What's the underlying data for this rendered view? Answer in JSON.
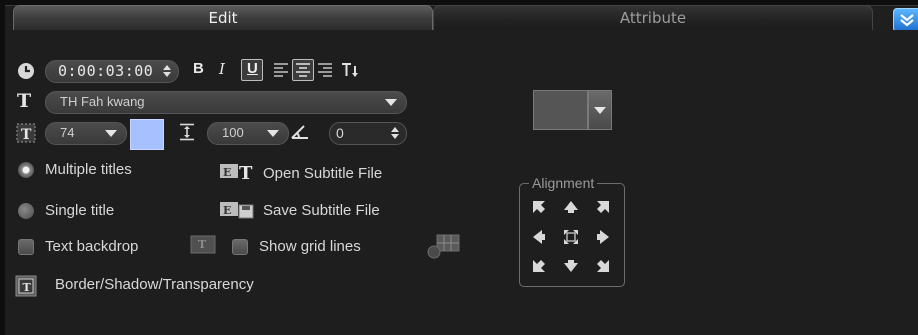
{
  "tabs": {
    "edit": "Edit",
    "attribute": "Attribute"
  },
  "time": {
    "value": "0:00:03:00"
  },
  "format": {
    "bold": "B",
    "italic": "I",
    "underline": "U"
  },
  "font": {
    "name": "TH Fah kwang",
    "size": "74",
    "line_spacing": "100",
    "rotation": "0"
  },
  "options": {
    "multiple_titles": "Multiple titles",
    "single_title": "Single title",
    "open_subtitle": "Open Subtitle File",
    "save_subtitle": "Save Subtitle File",
    "text_backdrop": "Text backdrop",
    "show_grid": "Show grid lines",
    "border_shadow": "Border/Shadow/Transparency"
  },
  "alignment": {
    "label": "Alignment"
  },
  "colors": {
    "font_color": "#a7c0ff",
    "accent": "#3a8ee6"
  },
  "icons": [
    "clock-icon",
    "bold-icon",
    "italic-icon",
    "underline-icon",
    "align-left-icon",
    "align-center-icon",
    "align-right-icon",
    "vertical-text-icon",
    "font-icon",
    "font-size-icon",
    "line-spacing-icon",
    "rotation-icon",
    "open-subtitle-icon",
    "save-subtitle-icon",
    "backdrop-icon",
    "grid-icon",
    "border-shadow-icon",
    "collapse-icon"
  ]
}
